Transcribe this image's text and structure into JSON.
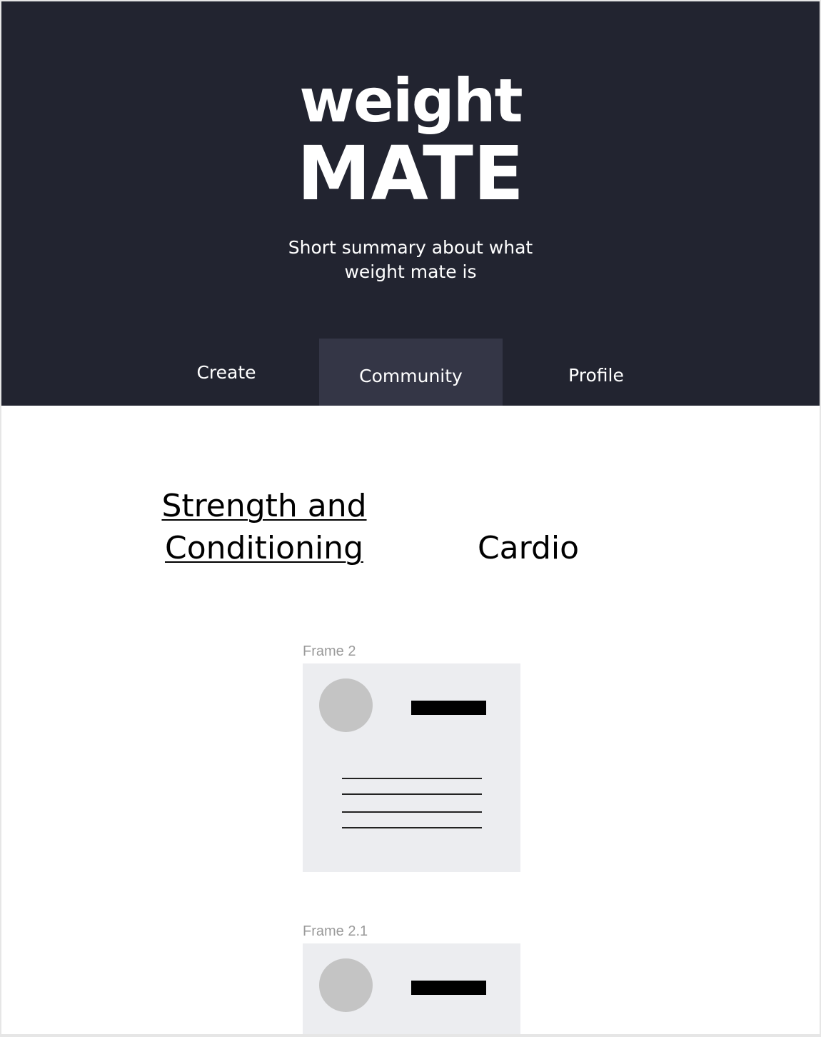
{
  "header": {
    "logo_top": "weight",
    "logo_bottom": "MATE",
    "summary_line1": "Short summary about what",
    "summary_line2": "weight mate is"
  },
  "nav": {
    "items": [
      {
        "label": "Create",
        "active": false
      },
      {
        "label": "Community",
        "active": true
      },
      {
        "label": "Profile",
        "active": false
      }
    ]
  },
  "categories": {
    "strength_line1": "Strength and",
    "strength_line2": "Conditioning",
    "cardio": "Cardio"
  },
  "frames": [
    {
      "label": "Frame 2"
    },
    {
      "label": "Frame 2.1"
    }
  ],
  "colors": {
    "header_bg": "#222430",
    "nav_active_bg": "#343646",
    "card_bg": "#ecedf0",
    "avatar_placeholder": "#c4c4c4"
  }
}
